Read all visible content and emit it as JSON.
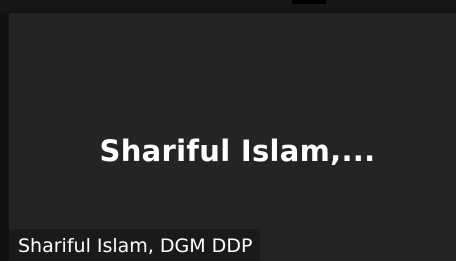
{
  "participant": {
    "display_name": "Shariful  Islam,...",
    "label": "Shariful Islam, DGM DDP"
  },
  "colors": {
    "background": "#111111",
    "tile": "#242424",
    "label_background": "#1a1a1a",
    "text": "#ffffff"
  }
}
